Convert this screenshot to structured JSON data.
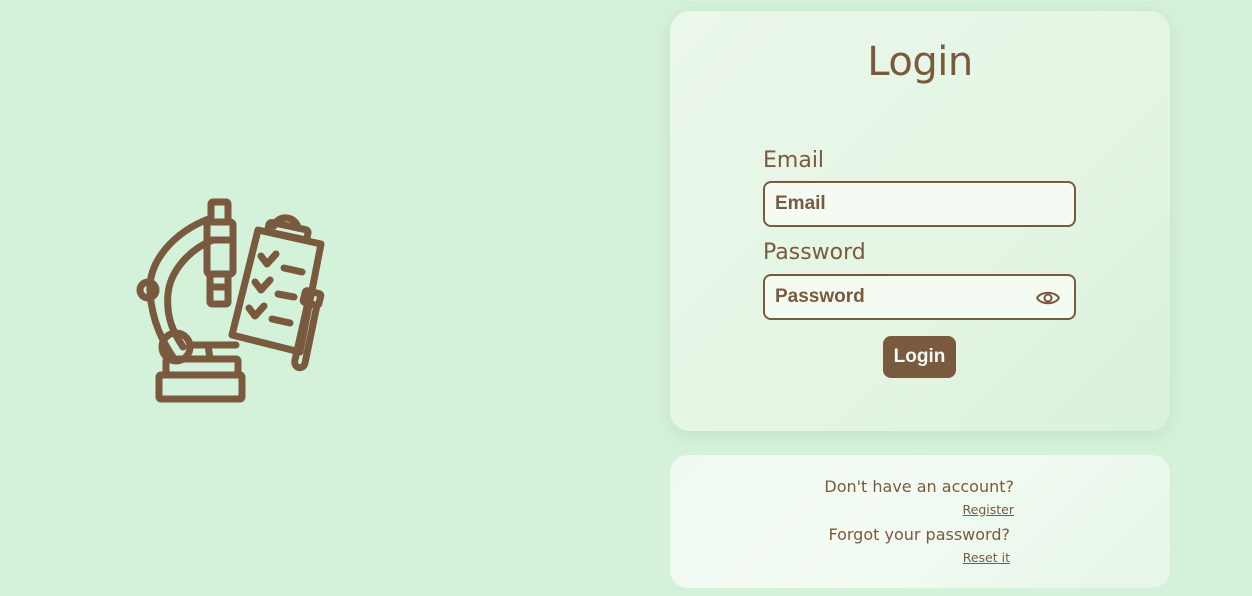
{
  "illustration": {
    "icon": "microscope-clipboard-test-tube-icon"
  },
  "login": {
    "title": "Login",
    "email_label": "Email",
    "email_placeholder": "Email",
    "password_label": "Password",
    "password_placeholder": "Password",
    "toggle_visibility_icon": "eye-icon",
    "submit_label": "Login"
  },
  "links": {
    "no_account_text": "Don't have an account?",
    "register_label": "Register",
    "forgot_text": "Forgot your password?",
    "reset_label": "Reset it"
  },
  "colors": {
    "background": "#d4f2da",
    "accent": "#7a5a3e",
    "field_background": "#f3fbf3"
  }
}
